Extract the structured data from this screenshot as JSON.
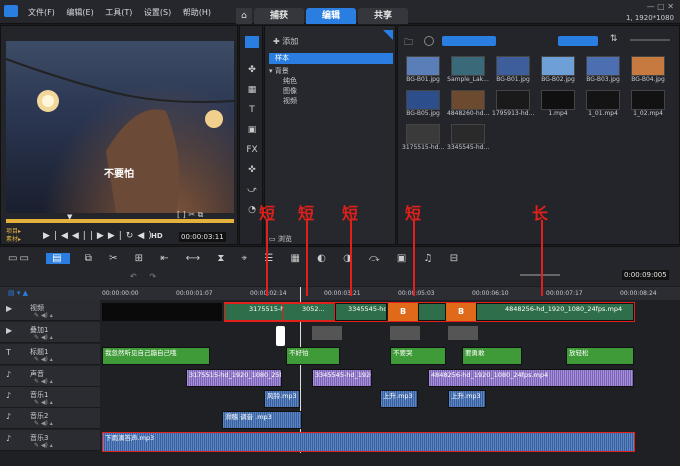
{
  "menu": [
    "文件(F)",
    "编辑(E)",
    "工具(T)",
    "设置(S)",
    "帮助(H)"
  ],
  "tabs": {
    "capture": "捕获",
    "edit": "编辑",
    "share": "共享"
  },
  "project_res": "1, 1920*1080",
  "preview": {
    "subtitle": "不要怕",
    "mode_project": "项目▸",
    "mode_clip": "素材▸",
    "hd": "HD",
    "timecode": "00:00:03:11"
  },
  "library": {
    "add_label": "添加",
    "tree": [
      "样本",
      "背景",
      "纯色",
      "图像",
      "视频"
    ],
    "browse_label": "浏览",
    "items": [
      {
        "name": "BG-B01.jpg",
        "color": "#5a7fb8"
      },
      {
        "name": "Sample_Lak...",
        "color": "#3a6a7a"
      },
      {
        "name": "BG-B01.jpg",
        "color": "#3d5e9a"
      },
      {
        "name": "BG-B02.jpg",
        "color": "#6e9fd6"
      },
      {
        "name": "BG-B03.jpg",
        "color": "#4b6fb0"
      },
      {
        "name": "BG-B04.jpg",
        "color": "#c77a40"
      },
      {
        "name": "BG-B05.jpg",
        "color": "#2c4f8c"
      },
      {
        "name": "4848260-hd...",
        "color": "#6c4a30"
      },
      {
        "name": "1795913-hd...",
        "color": "#1a1a1a"
      },
      {
        "name": "1.mp4",
        "color": "#101010"
      },
      {
        "name": "1_01.mp4",
        "color": "#141414"
      },
      {
        "name": "1_02.mp4",
        "color": "#121212"
      },
      {
        "name": "3175515-hd...",
        "color": "#3a3a3a"
      },
      {
        "name": "3345545-hd...",
        "color": "#2a2a2a"
      }
    ]
  },
  "timeline": {
    "zoom_time": "0:00:09:005",
    "ruler": [
      "00:00:00:00",
      "00:00:01:07",
      "00:00:02:14",
      "00:00:03:21",
      "00:00:05:03",
      "00:00:06:10",
      "00:00:07:17",
      "00:00:08:24"
    ],
    "tracks": [
      {
        "name": "视频"
      },
      {
        "name": "叠加1"
      },
      {
        "name": "标题1"
      },
      {
        "name": "声音"
      },
      {
        "name": "音乐1"
      },
      {
        "name": "音乐2"
      },
      {
        "name": "音乐3"
      }
    ],
    "video_clips": [
      "3175515-hd...",
      "3052...",
      "3345545-hd...",
      "4848256-hd_1920_1080_24fps.mp4"
    ],
    "titles": [
      "我忽然听见自己蹦自己哦",
      "不好怕",
      "不要哭",
      "要勇敢",
      "放轻松"
    ],
    "voice_clips": [
      "3175515-hd_1920_1080_25fps.m",
      "3345545-hd_1920...",
      "4848256-hd_1920_1080_24fps.mp4"
    ],
    "music1": [
      "风铃.mp3",
      "上升.mp3",
      "上升.mp3"
    ],
    "music2": [
      "滑稽 调音 .mp3"
    ],
    "music3": "下雨滴答声.mp3"
  },
  "annotations": {
    "short": "短",
    "long": "长"
  }
}
